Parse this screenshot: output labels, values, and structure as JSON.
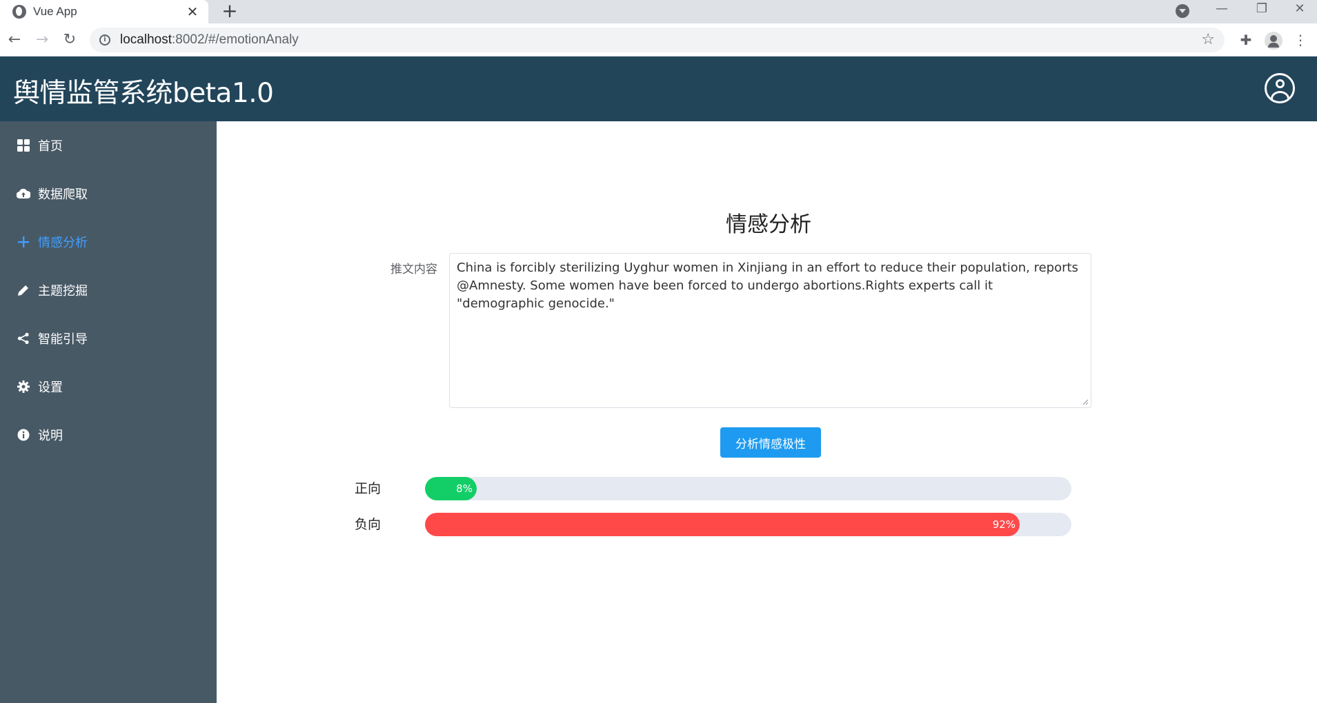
{
  "browser": {
    "tab_title": "Vue App",
    "url_host": "localhost",
    "url_rest": ":8002/#/emotionAnaly"
  },
  "header": {
    "title": "舆情监管系统beta1.0"
  },
  "sidebar": {
    "items": [
      {
        "label": "首页",
        "icon": "grid-icon"
      },
      {
        "label": "数据爬取",
        "icon": "cloud-upload-icon"
      },
      {
        "label": "情感分析",
        "icon": "plus-icon",
        "active": true
      },
      {
        "label": "主题挖掘",
        "icon": "pencil-icon"
      },
      {
        "label": "智能引导",
        "icon": "share-icon"
      },
      {
        "label": "设置",
        "icon": "gear-icon"
      },
      {
        "label": "说明",
        "icon": "info-icon"
      }
    ]
  },
  "main": {
    "title": "情感分析",
    "tweet_label": "推文内容",
    "tweet_text": "China is forcibly sterilizing Uyghur women in Xinjiang in an effort to reduce their population, reports @Amnesty. Some women have been forced to undergo abortions.Rights experts call it \"demographic genocide.\"",
    "analyze_button": "分析情感极性",
    "results": [
      {
        "label": "正向",
        "percent": 8,
        "percent_text": "8%",
        "color": "#13ce66"
      },
      {
        "label": "负向",
        "percent": 92,
        "percent_text": "92%",
        "color": "#ff4949"
      }
    ]
  },
  "colors": {
    "header_bg": "#22455a",
    "sidebar_bg": "#485966",
    "active": "#409eff",
    "button": "#1e9bf0"
  }
}
